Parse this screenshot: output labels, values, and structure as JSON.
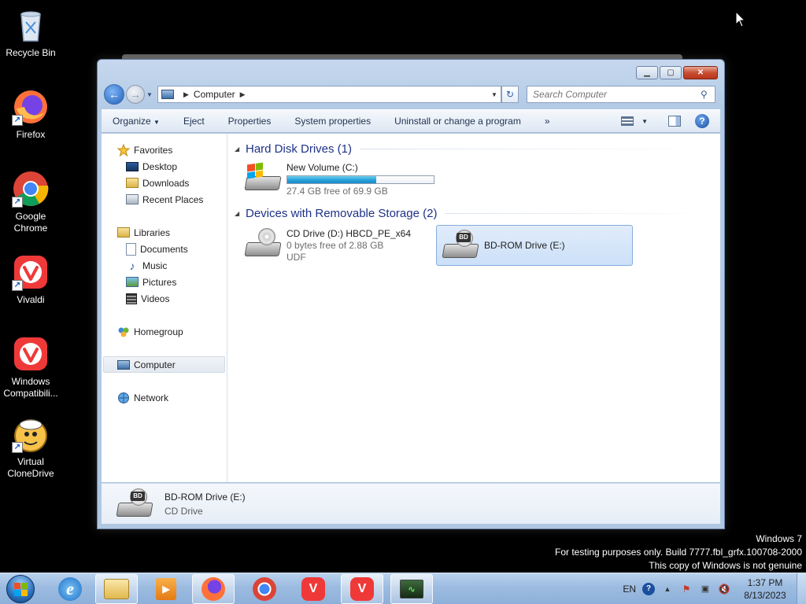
{
  "desktop": {
    "icons": [
      {
        "label": "Recycle Bin",
        "icon": "recycle-bin-icon"
      },
      {
        "label": "Firefox",
        "icon": "firefox-icon"
      },
      {
        "label": "Google Chrome",
        "icon": "chrome-icon"
      },
      {
        "label": "Vivaldi",
        "icon": "vivaldi-icon"
      },
      {
        "label": "Windows Compatibili...",
        "icon": "vivaldi-icon"
      },
      {
        "label": "Virtual CloneDrive",
        "icon": "virtual-clonedrive-icon"
      }
    ]
  },
  "window": {
    "address": {
      "crumb": "Computer"
    },
    "search": {
      "placeholder": "Search Computer"
    },
    "toolbar": {
      "organize": "Organize",
      "eject": "Eject",
      "properties": "Properties",
      "system_properties": "System properties",
      "uninstall": "Uninstall or change a program",
      "more": "»"
    },
    "nav_pane": {
      "favorites": "Favorites",
      "desktop": "Desktop",
      "downloads": "Downloads",
      "recent_places": "Recent Places",
      "libraries": "Libraries",
      "documents": "Documents",
      "music": "Music",
      "pictures": "Pictures",
      "videos": "Videos",
      "homegroup": "Homegroup",
      "computer": "Computer",
      "network": "Network"
    },
    "groups": {
      "hdd": {
        "title": "Hard Disk Drives (1)",
        "drives": [
          {
            "name": "New Volume (C:)",
            "free": "27.4 GB free of 69.9 GB",
            "used_fraction": 0.61
          }
        ]
      },
      "removable": {
        "title": "Devices with Removable Storage (2)",
        "drives": [
          {
            "name": "CD Drive (D:) HBCD_PE_x64",
            "free": "0 bytes free of 2.88 GB",
            "fs": "UDF"
          },
          {
            "name": "BD-ROM Drive (E:)",
            "badge": "BD"
          }
        ]
      }
    },
    "details": {
      "name": "BD-ROM Drive (E:)",
      "type": "CD Drive",
      "badge": "BD"
    }
  },
  "watermark": {
    "line1": "Windows 7",
    "line2": "For testing purposes only. Build 7777.fbl_grfx.100708-2000",
    "line3": "This copy of Windows is not genuine"
  },
  "taskbar": {
    "apps": [
      "explorer",
      "internet-explorer",
      "media-player",
      "firefox",
      "chrome",
      "vivaldi",
      "vivaldi",
      "task-manager"
    ],
    "tray": {
      "language": "EN",
      "time": "1:37 PM",
      "date": "8/13/2023"
    }
  },
  "colors": {
    "accent": "#26a0da",
    "group_heading": "#1e3287",
    "taskbar": "#9cbbe0"
  }
}
